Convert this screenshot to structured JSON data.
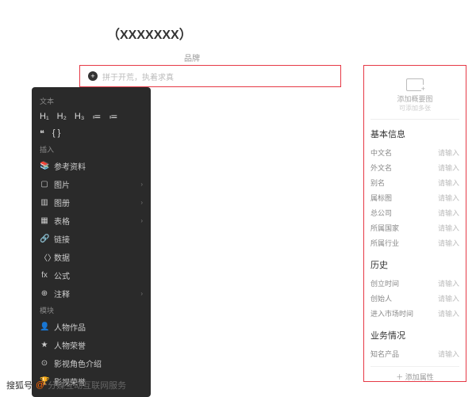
{
  "title": "（XXXXXXX）",
  "subtitle": "品牌",
  "mainInput": "拼于开荒，执着求真",
  "toolbar": {
    "groups": {
      "text": "文本",
      "insert": "插入",
      "module": "模块"
    },
    "headings": [
      "H₁",
      "H₂",
      "H₃",
      "≔",
      "≔"
    ],
    "row2": [
      "❝",
      "{ }"
    ],
    "insertItems": [
      {
        "icon": "📚",
        "label": "参考资料",
        "sub": false
      },
      {
        "icon": "▢",
        "label": "图片",
        "sub": true
      },
      {
        "icon": "▥",
        "label": "图册",
        "sub": true
      },
      {
        "icon": "▦",
        "label": "表格",
        "sub": true
      },
      {
        "icon": "🔗",
        "label": "链接",
        "sub": false
      },
      {
        "icon": "〈〉",
        "label": "数据",
        "sub": false
      },
      {
        "icon": "fx",
        "label": "公式",
        "sub": false
      },
      {
        "icon": "⊕",
        "label": "注释",
        "sub": true
      }
    ],
    "moduleItems": [
      {
        "icon": "👤",
        "label": "人物作品"
      },
      {
        "icon": "★",
        "label": "人物荣誉"
      },
      {
        "icon": "⊙",
        "label": "影视角色介绍"
      },
      {
        "icon": "🏆",
        "label": "影视荣誉"
      }
    ]
  },
  "rightPanel": {
    "uploadText": "添加概要图",
    "uploadSub": "可添加多张",
    "sections": [
      {
        "title": "基本信息",
        "fields": [
          {
            "label": "中文名",
            "value": "请输入"
          },
          {
            "label": "外文名",
            "value": "请输入"
          },
          {
            "label": "别名",
            "value": "请输入"
          },
          {
            "label": "属标图",
            "value": "请输入"
          },
          {
            "label": "总公司",
            "value": "请输入"
          },
          {
            "label": "所属国家",
            "value": "请输入"
          },
          {
            "label": "所属行业",
            "value": "请输入"
          }
        ]
      },
      {
        "title": "历史",
        "fields": [
          {
            "label": "创立时间",
            "value": "请输入"
          },
          {
            "label": "创始人",
            "value": "请输入"
          },
          {
            "label": "进入市场时间",
            "value": "请输入"
          }
        ]
      },
      {
        "title": "业务情况",
        "fields": [
          {
            "label": "知名产品",
            "value": "请输入"
          }
        ]
      }
    ],
    "addAttr": "＋ 添加属性"
  },
  "footer": {
    "site": "搜狐号",
    "sep": "@",
    "author": "分媒互动互联网服务"
  }
}
